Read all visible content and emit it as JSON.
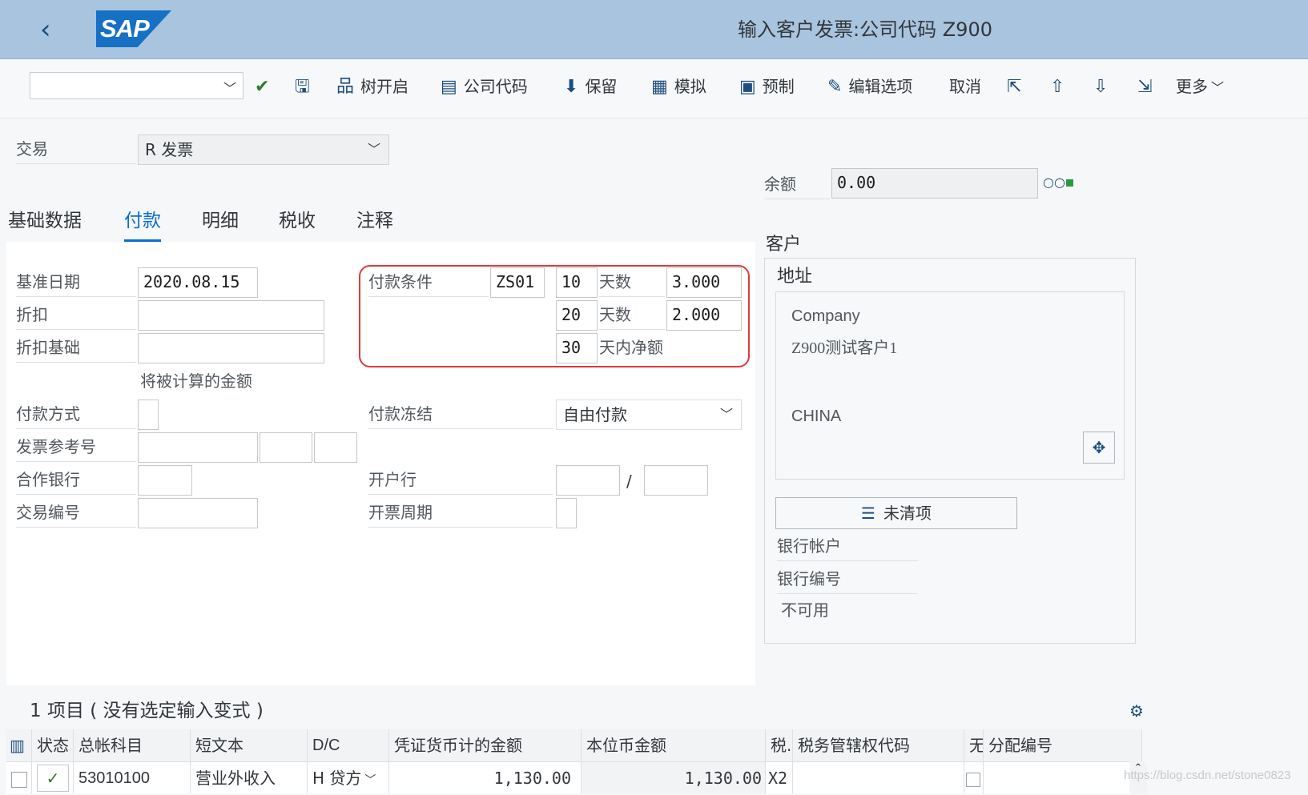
{
  "shell": {
    "title": "输入客户发票:公司代码 Z900",
    "logo": "SAP",
    "back_icon": "chevron-left-icon"
  },
  "toolbar": {
    "command_field": "",
    "items": [
      {
        "icon": "check-icon",
        "label": ""
      },
      {
        "icon": "save-icon",
        "label": ""
      },
      {
        "icon": "tree-icon",
        "label": "树开启"
      },
      {
        "icon": "company-code-icon",
        "label": "公司代码"
      },
      {
        "icon": "park-icon",
        "label": "保留"
      },
      {
        "icon": "simulate-icon",
        "label": "模拟"
      },
      {
        "icon": "prepare-icon",
        "label": "预制"
      },
      {
        "icon": "edit-icon",
        "label": "编辑选项"
      },
      {
        "icon": "",
        "label": "取消"
      },
      {
        "icon": "export-icon",
        "label": ""
      },
      {
        "icon": "upload-icon",
        "label": ""
      },
      {
        "icon": "download-icon",
        "label": ""
      },
      {
        "icon": "import-icon",
        "label": ""
      },
      {
        "icon": "chevron-down-icon",
        "label": "更多"
      }
    ]
  },
  "transaction": {
    "label": "交易",
    "value": "R 发票"
  },
  "balance": {
    "label": "余额",
    "value": "0.00",
    "status_colors": [
      "#1d4e7e",
      "#1d4e7e",
      "#2b9a3d"
    ]
  },
  "tabs": [
    {
      "label": "基础数据",
      "active": false
    },
    {
      "label": "付款",
      "active": true
    },
    {
      "label": "明细",
      "active": false
    },
    {
      "label": "税收",
      "active": false
    },
    {
      "label": "注释",
      "active": false
    }
  ],
  "payment": {
    "baseline_date_label": "基准日期",
    "baseline_date": "2020.08.15",
    "discount_label": "折扣",
    "discount_base_label": "折扣基础",
    "calc_note": "将被计算的金额",
    "pay_method_label": "付款方式",
    "invoice_ref_label": "发票参考号",
    "partner_bank_label": "合作银行",
    "txn_number_label": "交易编号",
    "terms_label": "付款条件",
    "terms_value": "ZS01",
    "terms_rows": [
      {
        "days": "10",
        "unit": "天数",
        "pct": "3.000"
      },
      {
        "days": "20",
        "unit": "天数",
        "pct": "2.000"
      },
      {
        "days": "30",
        "unit": "天内净额",
        "pct": ""
      }
    ],
    "block_label": "付款冻结",
    "block_value": "自由付款",
    "house_bank_label": "开户行",
    "house_bank_sep": "/",
    "invoicing_period_label": "开票周期"
  },
  "customer": {
    "section_label": "客户",
    "address_title": "地址",
    "lines": [
      "Company",
      "Z900测试客户1",
      "",
      "CHINA"
    ],
    "open_items_label": "未清项",
    "bank_account_label": "银行帐户",
    "bank_number_label": "银行编号",
    "unavailable": "不可用"
  },
  "items": {
    "title": "1 项目 ( 没有选定输入变式 )",
    "columns": [
      "状态",
      "总帐科目",
      "短文本",
      "D/C",
      "凭证货币计的金额",
      "本位币金额",
      "税.",
      "税务管辖权代码",
      "无",
      "分配编号"
    ],
    "rows": [
      {
        "status": "✓",
        "gl": "53010100",
        "text": "营业外收入",
        "dc": "H 贷方",
        "amount": "1,130.00",
        "local_amount": "1,130.00",
        "tax": "X2",
        "jurisdiction": "",
        "no_tax": "",
        "assignment": ""
      }
    ]
  },
  "watermark": "https://blog.csdn.net/stone0823"
}
